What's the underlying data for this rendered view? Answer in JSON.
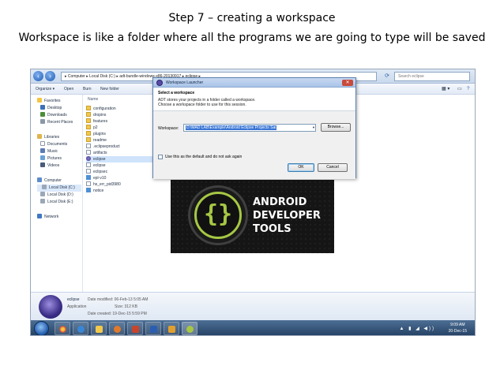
{
  "slide": {
    "title": "Step 7 – creating a workspace",
    "subtitle": "Workspace is like a folder where all the programs we are going to type will be saved"
  },
  "explorer": {
    "address": "▸ Computer ▸ Local Disk (C:) ▸ adt-bundle-windows-x86-20130917 ▸ eclipse ▸",
    "search_placeholder": "Search eclipse",
    "toolbar": {
      "organize": "Organize ▾",
      "open": "Open",
      "burn": "Burn",
      "new_folder": "New folder"
    },
    "sidebar": {
      "favorites": "Favorites",
      "desktop": "Desktop",
      "downloads": "Downloads",
      "recent": "Recent Places",
      "libraries": "Libraries",
      "documents": "Documents",
      "music": "Music",
      "pictures": "Pictures",
      "videos": "Videos",
      "computer": "Computer",
      "disk_c": "Local Disk (C:)",
      "disk_d": "Local Disk (D:)",
      "disk_e": "Local Disk (E:)",
      "network": "Network"
    },
    "files": {
      "header_name": "Name",
      "f1": "configuration",
      "f2": "dropins",
      "f3": "features",
      "f4": "p2",
      "f5": "plugins",
      "f6": "readme",
      "f7": ".eclipseproduct",
      "f8": "artifacts",
      "f9": "eclipse",
      "f10": "eclipse",
      "f11": "eclipsec",
      "f12": "epl-v10",
      "f13": "hs_err_pid3980",
      "f14": "notice"
    },
    "details": {
      "name": "eclipse",
      "type": "Application",
      "modified": "Date modified: 06-Feb-13 5:05 AM",
      "size": "Size: 312 KB",
      "created": "Date created: 19-Dec-15 5:59 PM"
    }
  },
  "dialog": {
    "title": "Workspace Launcher",
    "heading": "Select a workspace",
    "desc_line1": "ADT stores your projects in a folder called a workspace.",
    "desc_line2": "Choose a workspace folder to use for this session.",
    "workspace_label": "Workspace:",
    "workspace_value": "D:\\MAD LAB\\Example\\Android Eclipse Projects Sai",
    "browse_label": "Browse...",
    "checkbox_label": "Use this as the default and do not ask again",
    "ok_label": "OK",
    "cancel_label": "Cancel"
  },
  "splash": {
    "line1": "ANDROID",
    "line2": "DEVELOPER",
    "line3": "TOOLS"
  },
  "taskbar": {
    "time": "9:09 AM",
    "date": "20-Dec-15"
  },
  "colors": {
    "adt_green": "#a6c744",
    "taskbar": "#223f62",
    "selection": "#3874d4"
  }
}
